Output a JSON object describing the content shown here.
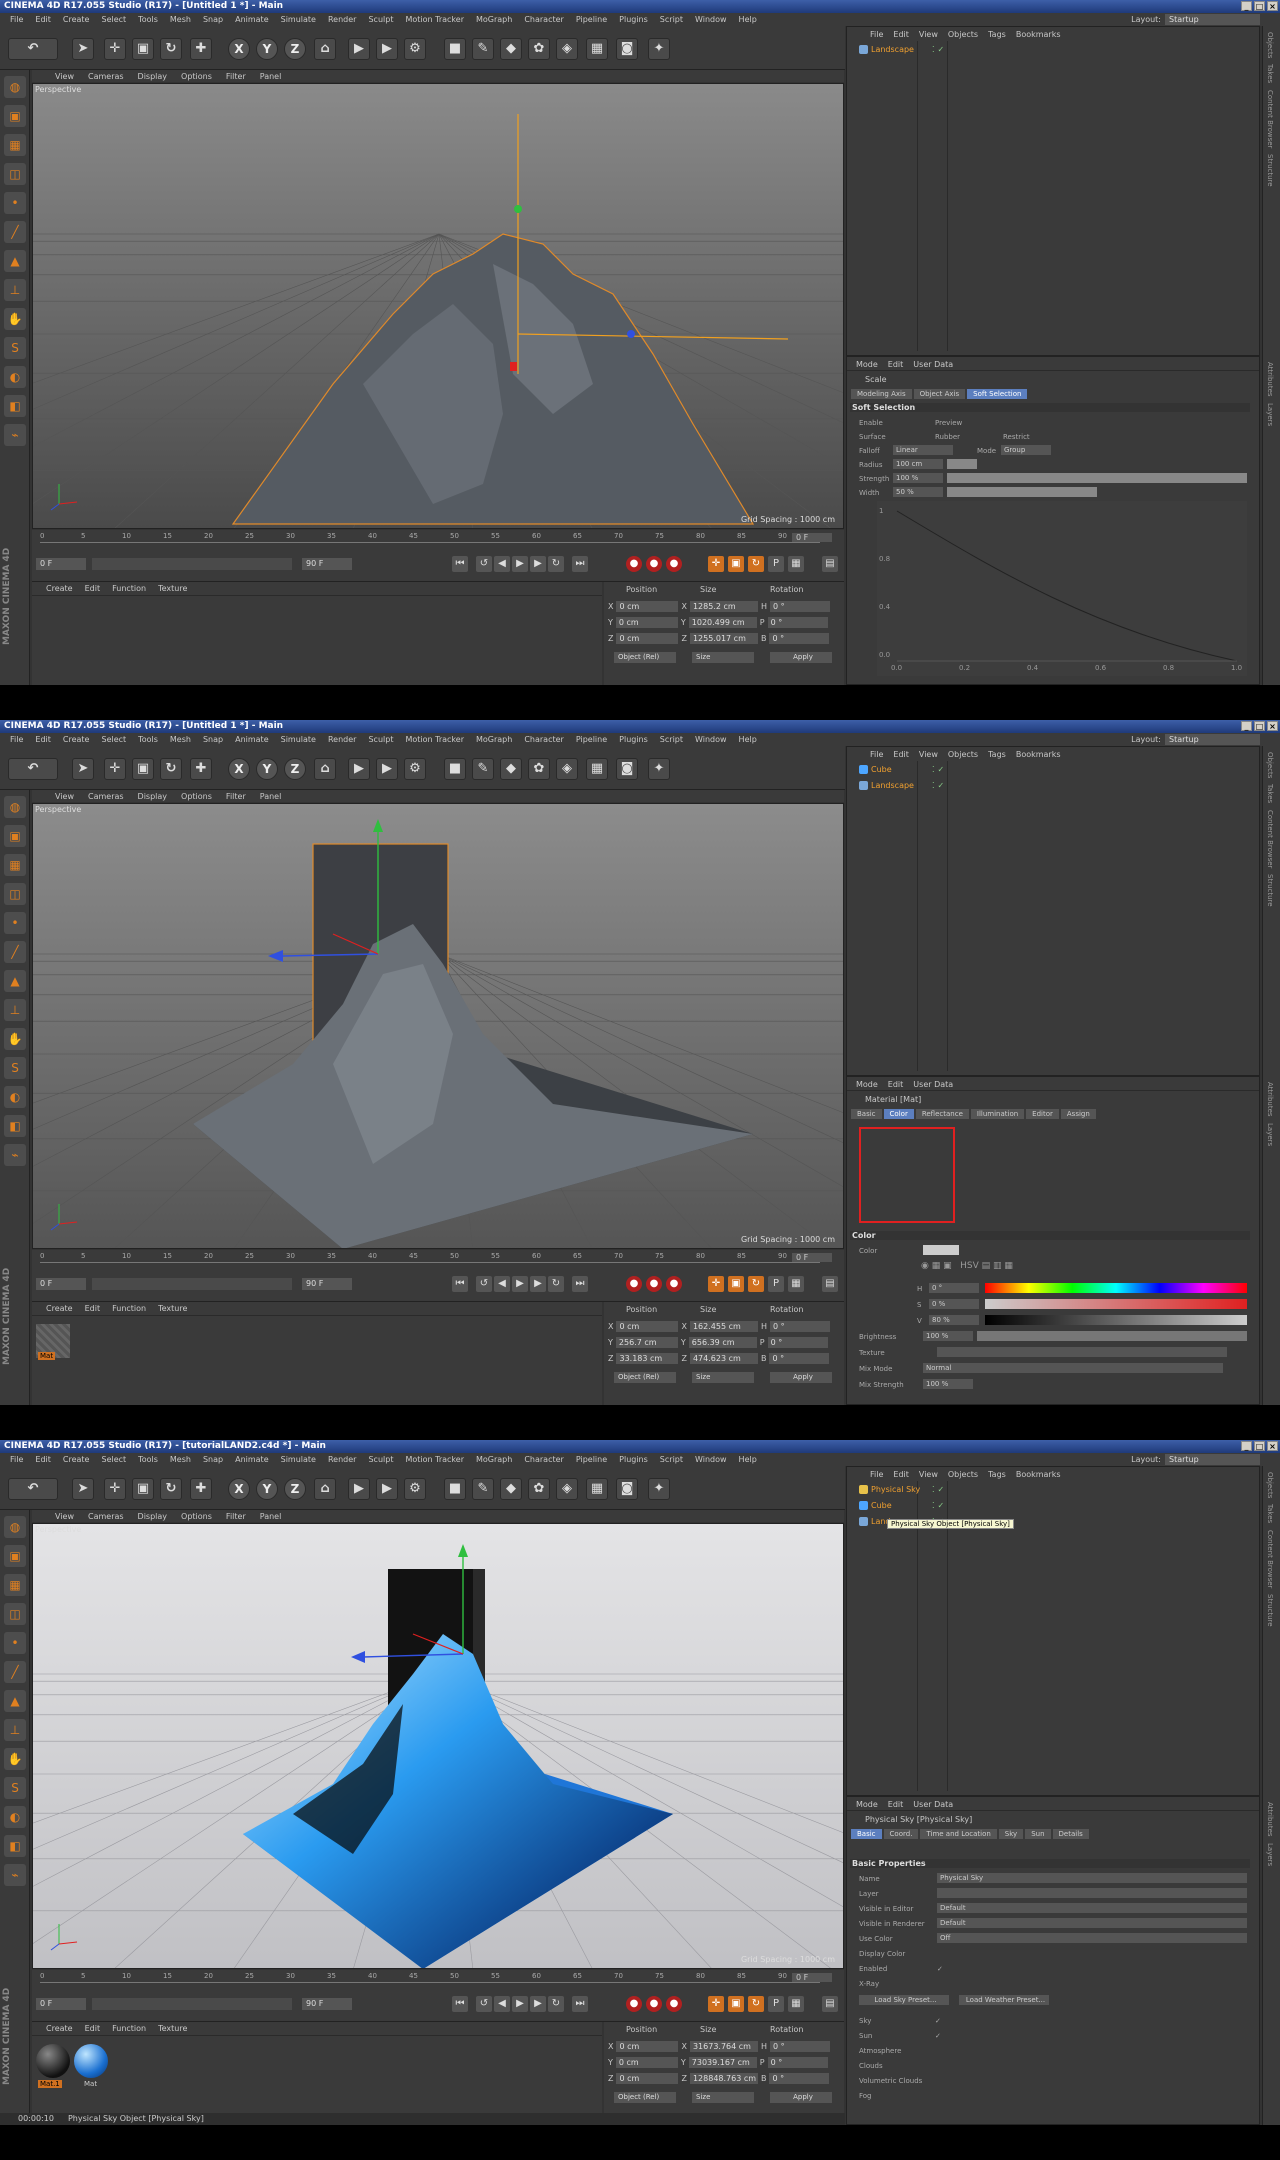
{
  "app_title_1": "CINEMA 4D R17.055 Studio (R17) - [Untitled 1 *] - Main",
  "app_title_2": "CINEMA 4D R17.055 Studio (R17) - [Untitled 1 *] - Main",
  "app_title_3": "CINEMA 4D R17.055 Studio (R17) - [tutorialLAND2.c4d *] - Main",
  "menu": [
    "File",
    "Edit",
    "Create",
    "Select",
    "Tools",
    "Mesh",
    "Snap",
    "Animate",
    "Simulate",
    "Render",
    "Sculpt",
    "Motion Tracker",
    "MoGraph",
    "Character",
    "Pipeline",
    "Plugins",
    "Script",
    "Window",
    "Help"
  ],
  "layout_label": "Layout:",
  "layout_value": "Startup",
  "viewport_menu": [
    "View",
    "Cameras",
    "Display",
    "Options",
    "Filter",
    "Panel"
  ],
  "viewport_name": "Perspective",
  "grid_spacing": "Grid Spacing : 1000 cm",
  "timeline_ticks": [
    "0",
    "5",
    "10",
    "15",
    "20",
    "25",
    "30",
    "35",
    "40",
    "45",
    "50",
    "55",
    "60",
    "65",
    "70",
    "75",
    "80",
    "85",
    "90"
  ],
  "current_frame": "0 F",
  "start_frame": "0 F",
  "end_frame": "90 F",
  "mat_menu": [
    "Create",
    "Edit",
    "Function",
    "Texture"
  ],
  "coord_headers": {
    "pos": "Position",
    "size": "Size",
    "rot": "Rotation"
  },
  "coord_mode": "Object (Rel)",
  "size_mode": "Size",
  "apply": "Apply",
  "obj_menu": [
    "File",
    "Edit",
    "View",
    "Objects",
    "Tags",
    "Bookmarks"
  ],
  "attr_menu": [
    "Mode",
    "Edit",
    "User Data"
  ],
  "right_strip": [
    "Objects",
    "Takes",
    "Content Browser",
    "Structure"
  ],
  "right_strip_attr": [
    "Attributes",
    "Layers"
  ],
  "f1": {
    "objects": [
      "Landscape"
    ],
    "coords": [
      {
        "axis": "X",
        "pos": "0 cm",
        "sax": "X",
        "size": "1285.2 cm",
        "rax": "H",
        "rot": "0 °"
      },
      {
        "axis": "Y",
        "pos": "0 cm",
        "sax": "Y",
        "size": "1020.499 cm",
        "rax": "P",
        "rot": "0 °"
      },
      {
        "axis": "Z",
        "pos": "0 cm",
        "sax": "Z",
        "size": "1255.017 cm",
        "rax": "B",
        "rot": "0 °"
      }
    ],
    "attr_title": "Scale",
    "attr_tabs": [
      "Modeling Axis",
      "Object Axis",
      "Soft Selection"
    ],
    "section": "Soft Selection",
    "rows": [
      "Enable",
      "Surface",
      "Falloff",
      "Radius",
      "Strength",
      "Width"
    ],
    "extra_labels": [
      "Preview",
      "Rubber",
      "Restrict",
      "Mode"
    ],
    "falloff_value": "Linear",
    "mode_value": "Group",
    "radius_value": "100 cm",
    "strength_value": "100 %",
    "width_value": "50 %",
    "graph_y": [
      "1",
      "0.8",
      "0.4",
      "0.0"
    ],
    "graph_x": [
      "0.0",
      "0.2",
      "0.4",
      "0.6",
      "0.8",
      "1.0"
    ]
  },
  "f2": {
    "objects": [
      "Cube",
      "Landscape"
    ],
    "coords": [
      {
        "axis": "X",
        "pos": "0 cm",
        "sax": "X",
        "size": "162.455 cm",
        "rax": "H",
        "rot": "0 °"
      },
      {
        "axis": "Y",
        "pos": "256.7 cm",
        "sax": "Y",
        "size": "656.39 cm",
        "rax": "P",
        "rot": "0 °"
      },
      {
        "axis": "Z",
        "pos": "33.183 cm",
        "sax": "Z",
        "size": "474.623 cm",
        "rax": "B",
        "rot": "0 °"
      }
    ],
    "attr_title": "Material [Mat]",
    "attr_tabs": [
      "Basic",
      "Color",
      "Reflectance",
      "Illumination",
      "Editor",
      "Assign"
    ],
    "section": "Color",
    "color_label": "Color",
    "hsv": [
      {
        "k": "H",
        "v": "0 °"
      },
      {
        "k": "S",
        "v": "0 %"
      },
      {
        "k": "V",
        "v": "80 %"
      }
    ],
    "brightness_label": "Brightness",
    "brightness_value": "100 %",
    "texture_label": "Texture",
    "mix_mode_label": "Mix Mode",
    "mix_mode_value": "Normal",
    "mix_strength_label": "Mix Strength",
    "mix_strength_value": "100 %",
    "material_label": "Mat",
    "accent": "#e02020"
  },
  "f3": {
    "objects": [
      "Physical Sky",
      "Cube",
      "Landscape"
    ],
    "tooltip": "Physical Sky Object [Physical Sky]",
    "coords": [
      {
        "axis": "X",
        "pos": "0 cm",
        "sax": "X",
        "size": "31673.764 cm",
        "rax": "H",
        "rot": "0 °"
      },
      {
        "axis": "Y",
        "pos": "0 cm",
        "sax": "Y",
        "size": "73039.167 cm",
        "rax": "P",
        "rot": "0 °"
      },
      {
        "axis": "Z",
        "pos": "0 cm",
        "sax": "Z",
        "size": "128848.763 cm",
        "rax": "B",
        "rot": "0 °"
      }
    ],
    "attr_title": "Physical Sky [Physical Sky]",
    "attr_tabs": [
      "Basic",
      "Coord.",
      "Time and Location",
      "Sky",
      "Sun",
      "Details"
    ],
    "section": "Basic Properties",
    "props": [
      {
        "k": "Name",
        "v": "Physical Sky"
      },
      {
        "k": "Layer",
        "v": ""
      },
      {
        "k": "Visible in Editor",
        "v": "Default"
      },
      {
        "k": "Visible in Renderer",
        "v": "Default"
      },
      {
        "k": "Use Color",
        "v": "Off"
      },
      {
        "k": "Display Color",
        "v": ""
      },
      {
        "k": "Enabled",
        "v": "✓"
      },
      {
        "k": "X-Ray",
        "v": ""
      }
    ],
    "preset_buttons": [
      "Load Sky Preset...",
      "Load Weather Preset..."
    ],
    "checks": [
      {
        "k": "Sky",
        "v": "✓"
      },
      {
        "k": "Sun",
        "v": "✓"
      },
      {
        "k": "Atmosphere",
        "v": ""
      },
      {
        "k": "Clouds",
        "v": ""
      },
      {
        "k": "Volumetric Clouds",
        "v": ""
      },
      {
        "k": "Fog",
        "v": ""
      }
    ],
    "materials": [
      "Mat.1",
      "Mat"
    ],
    "status_time": "00:00:10",
    "status_text": "Physical Sky Object [Physical Sky]"
  }
}
